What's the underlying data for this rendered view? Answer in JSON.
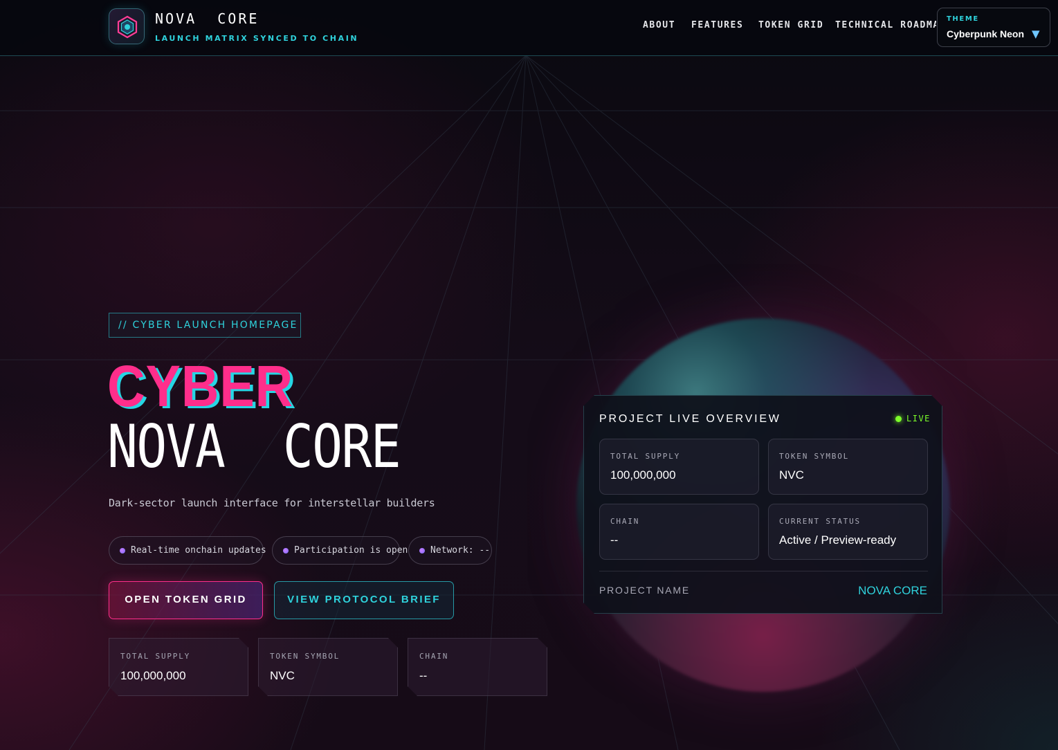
{
  "header": {
    "brand_name": "NOVA  CORE",
    "brand_tagline": "LAUNCH MATRIX SYNCED TO CHAIN",
    "logo_icon": "hexagon-core-icon",
    "nav": [
      "ABOUT",
      "FEATURES",
      "TOKEN GRID",
      "TECHNICAL ROADMAP"
    ],
    "theme": {
      "label": "THEME",
      "value": "Cyberpunk Neon",
      "caret": "▼"
    }
  },
  "hero": {
    "eyebrow": "// CYBER LAUNCH HOMEPAGE",
    "title_line1": "CYBER",
    "title_line2": "NOVA  CORE",
    "subtitle": "Dark-sector launch interface for interstellar builders",
    "pills": [
      "Real-time onchain updates",
      "Participation is open",
      "Network: --"
    ],
    "primary_button": "OPEN TOKEN GRID",
    "secondary_button": "VIEW PROTOCOL BRIEF",
    "stats": [
      {
        "label": "TOTAL SUPPLY",
        "value": "100,000,000"
      },
      {
        "label": "TOKEN SYMBOL",
        "value": "NVC"
      },
      {
        "label": "CHAIN",
        "value": "--"
      }
    ]
  },
  "overview": {
    "title": "PROJECT LIVE OVERVIEW",
    "live_label": "LIVE",
    "tiles": [
      {
        "label": "TOTAL SUPPLY",
        "value": "100,000,000"
      },
      {
        "label": "TOKEN SYMBOL",
        "value": "NVC"
      },
      {
        "label": "CHAIN",
        "value": "--"
      },
      {
        "label": "CURRENT STATUS",
        "value": "Active / Preview-ready"
      }
    ],
    "project_name_label": "PROJECT NAME",
    "project_name_value": "NOVA CORE"
  },
  "colors": {
    "accent_pink": "#ff2e8b",
    "accent_cyan": "#2fd2dc",
    "live_green": "#7dff2a",
    "background": "#0b0a12"
  }
}
